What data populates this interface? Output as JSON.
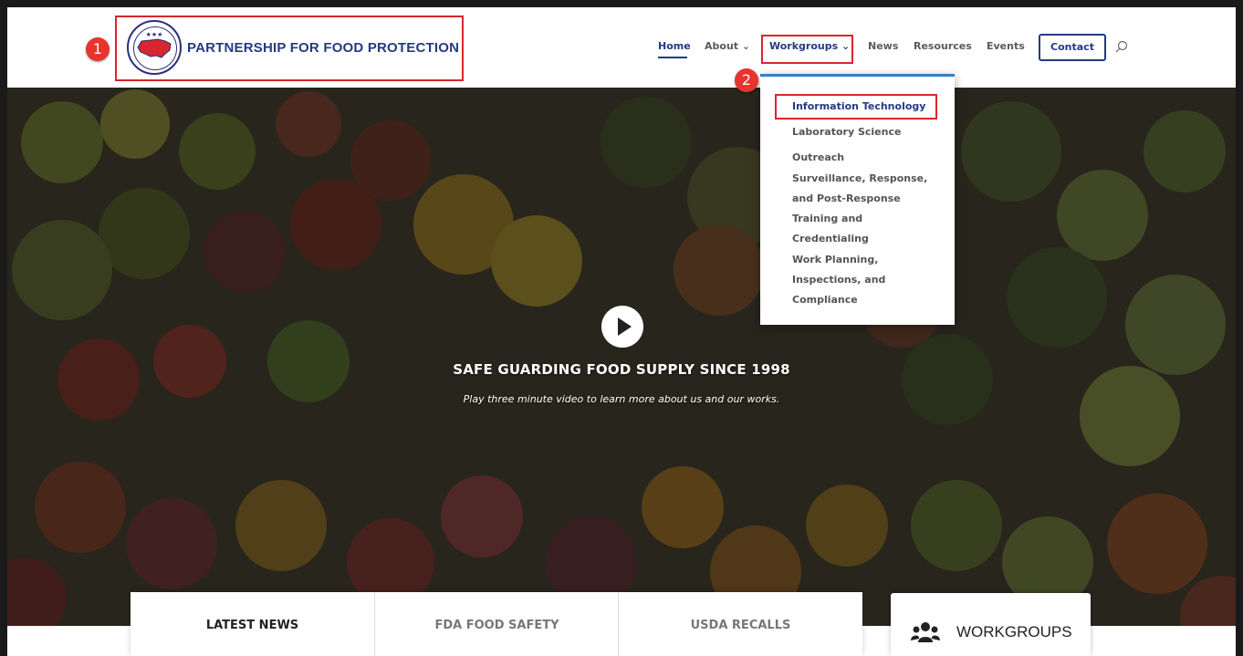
{
  "brand": {
    "name": "PARTNERSHIP FOR FOOD PROTECTION",
    "logo_icon": "usa-map-seal-icon"
  },
  "annotations": {
    "marker_1": "1",
    "marker_2": "2"
  },
  "nav": {
    "home": "Home",
    "about": "About",
    "workgroups": "Workgroups",
    "news": "News",
    "resources": "Resources",
    "events": "Events",
    "contact": "Contact",
    "search_icon": "search-icon",
    "caret": "⌄"
  },
  "dropdown": {
    "items": [
      "Information Technology",
      "Laboratory Science",
      "Outreach",
      "Surveillance, Response, and Post-Response",
      "Training and Credentialing",
      "Work Planning, Inspections, and Compliance"
    ]
  },
  "hero": {
    "title": "SAFE GUARDING FOOD SUPPLY SINCE 1998",
    "subtitle": "Play three minute video to learn more about us and our works."
  },
  "tabs": [
    "LATEST NEWS",
    "FDA FOOD SAFETY",
    "USDA RECALLS"
  ],
  "workgroups_card": {
    "label": "WORKGROUPS",
    "icon": "users-group-icon"
  },
  "colors": {
    "brand_blue": "#243a84",
    "annotation_red": "#d8262f",
    "dropdown_accent": "#3a7fc0"
  }
}
